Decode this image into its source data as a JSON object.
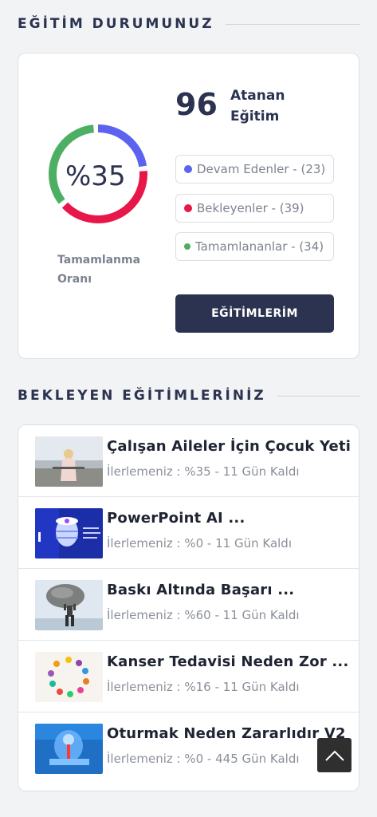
{
  "status_section": {
    "title": "EĞİTİM DURUMUNUZ",
    "percent_label": "%35",
    "completion_fraction": 0.35,
    "rate_label_line1": "Tamamlanma",
    "rate_label_line2": "Oranı",
    "assigned_count": "96",
    "assigned_label_line1": "Atanan",
    "assigned_label_line2": "Eğitim",
    "legend": [
      {
        "label": "Devam Edenler - (23)",
        "color": "#5b63f0"
      },
      {
        "label": "Bekleyenler - (39)",
        "color": "#e8174a"
      },
      {
        "label": "Tamamlananlar - (34)",
        "color": "#4caf63"
      }
    ],
    "button_label": "EĞİTİMLERİM"
  },
  "pending_section": {
    "title": "BEKLEYEN EĞİTİMLERİNİZ",
    "items": [
      {
        "title": "Çalışan Aileler İçin Çocuk Yeti ...",
        "progress": "İlerlemeniz : %35 - 11 Gün Kaldı",
        "thumb_icon": "woman-standing-image"
      },
      {
        "title": "PowerPoint AI ...",
        "progress": "İlerlemeniz : %0 - 11 Gün Kaldı",
        "thumb_icon": "ai-device-image"
      },
      {
        "title": "Baskı Altında Başarı ...",
        "progress": "İlerlemeniz : %60 - 11 Gün Kaldı",
        "thumb_icon": "man-carrying-rock-image"
      },
      {
        "title": "Kanser Tedavisi Neden Zor ...",
        "progress": "İlerlemeniz : %16 - 11 Gün Kaldı",
        "thumb_icon": "ribbons-circle-image"
      },
      {
        "title": "Oturmak Neden Zararlıdır V2 ...",
        "progress": "İlerlemeniz : %0 - 445 Gün Kaldı",
        "thumb_icon": "spine-anatomy-image"
      }
    ]
  },
  "scroll_top_icon": "chevron-up-icon"
}
